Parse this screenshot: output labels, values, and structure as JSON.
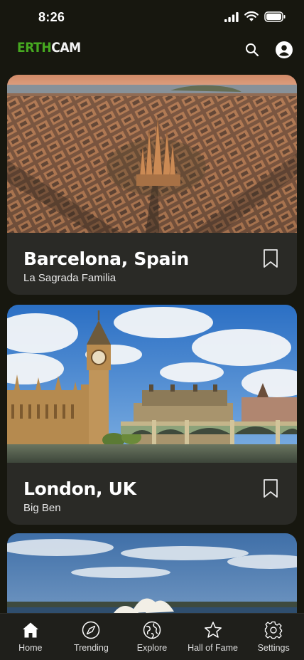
{
  "status_bar": {
    "time": "8:26",
    "icons": [
      "cellular-signal-icon",
      "wifi-icon",
      "battery-icon"
    ]
  },
  "header": {
    "logo_part1": "ERTH",
    "logo_part2": "CAM",
    "actions": [
      "search-icon",
      "account-icon"
    ]
  },
  "feed": {
    "cards": [
      {
        "title": "Barcelona, Spain",
        "subtitle": "La Sagrada Familia",
        "bookmark_icon": "bookmark-icon"
      },
      {
        "title": "London, UK",
        "subtitle": "Big Ben",
        "bookmark_icon": "bookmark-icon"
      },
      {
        "title": "",
        "subtitle": ""
      }
    ]
  },
  "tab_bar": {
    "tabs": [
      {
        "label": "Home",
        "icon": "home-icon",
        "active": true
      },
      {
        "label": "Trending",
        "icon": "compass-icon",
        "active": false
      },
      {
        "label": "Explore",
        "icon": "globe-icon",
        "active": false
      },
      {
        "label": "Hall of Fame",
        "icon": "star-icon",
        "active": false
      },
      {
        "label": "Settings",
        "icon": "gear-icon",
        "active": false
      }
    ]
  },
  "colors": {
    "background": "#17170f",
    "card": "#2a2a26",
    "logo_green": "#46a820"
  }
}
